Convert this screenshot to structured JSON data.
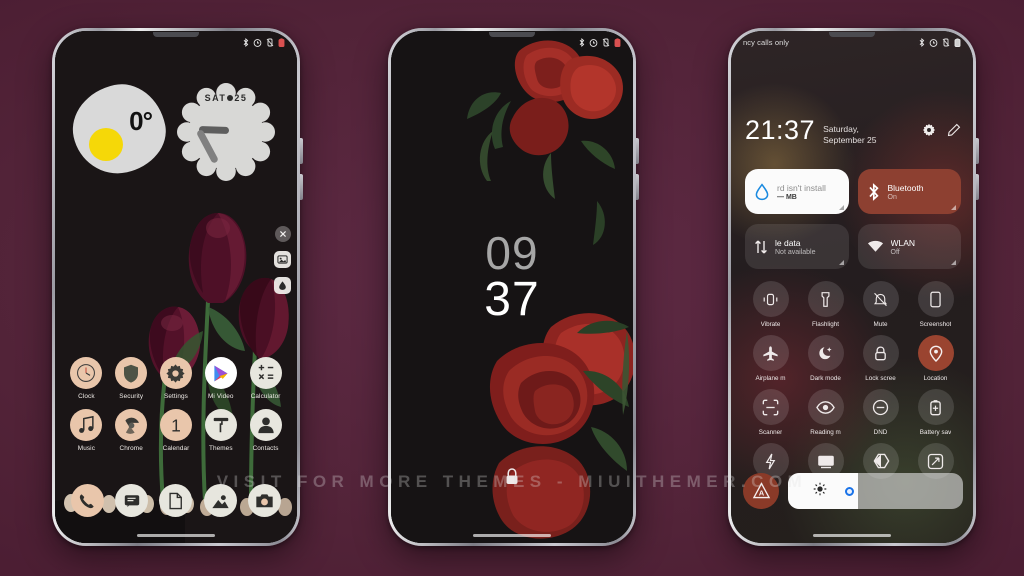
{
  "theme": {
    "background_color": "#522338",
    "accent_brown": "#8d4031",
    "accent_peach": "#e9c6ab",
    "yolk_yellow": "#f5d808",
    "slider_blue": "#1a73e8"
  },
  "watermark": {
    "text": "VISIT FOR MORE THEMES - MIUITHEMER.COM"
  },
  "phone1": {
    "name": "home-screen",
    "statusbar": {
      "left_text": "",
      "icons": [
        "bluetooth-icon",
        "alarm-icon",
        "vibrate-icon",
        "battery-icon"
      ]
    },
    "weather_widget": {
      "temperature": "0°",
      "name": "weather-widget"
    },
    "clock_widget": {
      "day": "SAT",
      "date": "25"
    },
    "side_tools": [
      "close-icon",
      "wallpaper-icon",
      "droplet-icon"
    ],
    "apps": [
      {
        "label": "Clock",
        "icon": "clock-icon",
        "style": "peach"
      },
      {
        "label": "Security",
        "icon": "shield-icon",
        "style": "peach"
      },
      {
        "label": "Settings",
        "icon": "gear-icon",
        "style": "peach"
      },
      {
        "label": "Mi Video",
        "icon": "play-icon",
        "style": "white"
      },
      {
        "label": "Calculator",
        "icon": "calculator-icon",
        "style": "lt"
      },
      {
        "label": "Music",
        "icon": "music-icon",
        "style": "peach"
      },
      {
        "label": "Chrome",
        "icon": "chrome-icon",
        "style": "peach"
      },
      {
        "label": "Calendar",
        "icon": "calendar-icon",
        "style": "peach"
      },
      {
        "label": "Themes",
        "icon": "paintroller-icon",
        "style": "lt"
      },
      {
        "label": "Contacts",
        "icon": "contacts-icon",
        "style": "lt"
      }
    ],
    "page_dots": {
      "count": 4,
      "active_index": 1
    },
    "dock": [
      {
        "label": "Phone",
        "icon": "phone-icon",
        "style": "peach"
      },
      {
        "label": "Messages",
        "icon": "message-icon",
        "style": "lt"
      },
      {
        "label": "Files",
        "icon": "file-icon",
        "style": "lt"
      },
      {
        "label": "Gallery",
        "icon": "gallery-icon",
        "style": "lt"
      },
      {
        "label": "Camera",
        "icon": "camera-icon",
        "style": "lt"
      }
    ]
  },
  "phone2": {
    "name": "lock-screen",
    "statusbar": {
      "icons": [
        "bluetooth-icon",
        "alarm-icon",
        "vibrate-icon",
        "battery-icon"
      ]
    },
    "clock": {
      "hours": "09",
      "minutes": "37"
    },
    "lock_icon": "lock-icon"
  },
  "phone3": {
    "name": "control-center",
    "statusbar": {
      "left_text": "ncy calls only",
      "icons": [
        "bluetooth-icon",
        "alarm-icon",
        "vibrate-icon",
        "battery-icon"
      ]
    },
    "time": "21:37",
    "date": "Saturday, September 25",
    "actions": [
      "gear-icon",
      "pencil-icon"
    ],
    "big_tiles": [
      {
        "title": "rd isn't install",
        "subtitle": "— MB",
        "icon": "droplet-icon",
        "style": "white"
      },
      {
        "title": "Bluetooth",
        "subtitle": "On",
        "icon": "bluetooth-icon",
        "style": "brown"
      },
      {
        "title": "le data",
        "subtitle": "Not available",
        "icon": "datatransfer-icon",
        "style": "dark"
      },
      {
        "title": "WLAN",
        "subtitle": "Off",
        "icon": "wifi-icon",
        "style": "dark"
      }
    ],
    "tiles": [
      {
        "label": "Vibrate",
        "icon": "vibrate-icon",
        "active": false
      },
      {
        "label": "Flashlight",
        "icon": "flashlight-icon",
        "active": false
      },
      {
        "label": "Mute",
        "icon": "mute-icon",
        "active": false
      },
      {
        "label": "Screenshot",
        "icon": "screenshot-icon",
        "active": false
      },
      {
        "label": "Airplane m",
        "icon": "airplane-icon",
        "active": false
      },
      {
        "label": "Dark mode",
        "icon": "moon-icon",
        "active": false
      },
      {
        "label": "Lock scree",
        "icon": "lock-icon",
        "active": false
      },
      {
        "label": "Location",
        "icon": "location-icon",
        "active": true
      },
      {
        "label": "Scanner",
        "icon": "scanner-icon",
        "active": false
      },
      {
        "label": "Reading m",
        "icon": "eye-icon",
        "active": false
      },
      {
        "label": "DND",
        "icon": "dnd-icon",
        "active": false
      },
      {
        "label": "Battery sav",
        "icon": "battery-plus-icon",
        "active": false
      },
      {
        "label": "",
        "icon": "bolt-icon",
        "active": false
      },
      {
        "label": "",
        "icon": "cast-icon",
        "active": false
      },
      {
        "label": "",
        "icon": "colorinvert-icon",
        "active": false
      },
      {
        "label": "",
        "icon": "resize-icon",
        "active": false
      }
    ],
    "brightness": {
      "auto_label": "A",
      "auto_icon": "auto-brightness-icon",
      "level_percent": 40
    }
  }
}
